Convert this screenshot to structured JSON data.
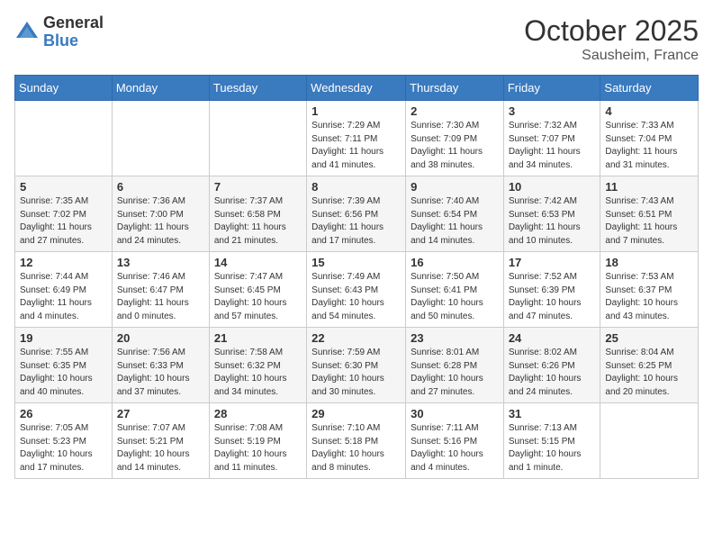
{
  "logo": {
    "general": "General",
    "blue": "Blue"
  },
  "header": {
    "month": "October 2025",
    "location": "Sausheim, France"
  },
  "days_of_week": [
    "Sunday",
    "Monday",
    "Tuesday",
    "Wednesday",
    "Thursday",
    "Friday",
    "Saturday"
  ],
  "weeks": [
    [
      {
        "num": "",
        "content": ""
      },
      {
        "num": "",
        "content": ""
      },
      {
        "num": "",
        "content": ""
      },
      {
        "num": "1",
        "content": "Sunrise: 7:29 AM\nSunset: 7:11 PM\nDaylight: 11 hours and 41 minutes."
      },
      {
        "num": "2",
        "content": "Sunrise: 7:30 AM\nSunset: 7:09 PM\nDaylight: 11 hours and 38 minutes."
      },
      {
        "num": "3",
        "content": "Sunrise: 7:32 AM\nSunset: 7:07 PM\nDaylight: 11 hours and 34 minutes."
      },
      {
        "num": "4",
        "content": "Sunrise: 7:33 AM\nSunset: 7:04 PM\nDaylight: 11 hours and 31 minutes."
      }
    ],
    [
      {
        "num": "5",
        "content": "Sunrise: 7:35 AM\nSunset: 7:02 PM\nDaylight: 11 hours and 27 minutes."
      },
      {
        "num": "6",
        "content": "Sunrise: 7:36 AM\nSunset: 7:00 PM\nDaylight: 11 hours and 24 minutes."
      },
      {
        "num": "7",
        "content": "Sunrise: 7:37 AM\nSunset: 6:58 PM\nDaylight: 11 hours and 21 minutes."
      },
      {
        "num": "8",
        "content": "Sunrise: 7:39 AM\nSunset: 6:56 PM\nDaylight: 11 hours and 17 minutes."
      },
      {
        "num": "9",
        "content": "Sunrise: 7:40 AM\nSunset: 6:54 PM\nDaylight: 11 hours and 14 minutes."
      },
      {
        "num": "10",
        "content": "Sunrise: 7:42 AM\nSunset: 6:53 PM\nDaylight: 11 hours and 10 minutes."
      },
      {
        "num": "11",
        "content": "Sunrise: 7:43 AM\nSunset: 6:51 PM\nDaylight: 11 hours and 7 minutes."
      }
    ],
    [
      {
        "num": "12",
        "content": "Sunrise: 7:44 AM\nSunset: 6:49 PM\nDaylight: 11 hours and 4 minutes."
      },
      {
        "num": "13",
        "content": "Sunrise: 7:46 AM\nSunset: 6:47 PM\nDaylight: 11 hours and 0 minutes."
      },
      {
        "num": "14",
        "content": "Sunrise: 7:47 AM\nSunset: 6:45 PM\nDaylight: 10 hours and 57 minutes."
      },
      {
        "num": "15",
        "content": "Sunrise: 7:49 AM\nSunset: 6:43 PM\nDaylight: 10 hours and 54 minutes."
      },
      {
        "num": "16",
        "content": "Sunrise: 7:50 AM\nSunset: 6:41 PM\nDaylight: 10 hours and 50 minutes."
      },
      {
        "num": "17",
        "content": "Sunrise: 7:52 AM\nSunset: 6:39 PM\nDaylight: 10 hours and 47 minutes."
      },
      {
        "num": "18",
        "content": "Sunrise: 7:53 AM\nSunset: 6:37 PM\nDaylight: 10 hours and 43 minutes."
      }
    ],
    [
      {
        "num": "19",
        "content": "Sunrise: 7:55 AM\nSunset: 6:35 PM\nDaylight: 10 hours and 40 minutes."
      },
      {
        "num": "20",
        "content": "Sunrise: 7:56 AM\nSunset: 6:33 PM\nDaylight: 10 hours and 37 minutes."
      },
      {
        "num": "21",
        "content": "Sunrise: 7:58 AM\nSunset: 6:32 PM\nDaylight: 10 hours and 34 minutes."
      },
      {
        "num": "22",
        "content": "Sunrise: 7:59 AM\nSunset: 6:30 PM\nDaylight: 10 hours and 30 minutes."
      },
      {
        "num": "23",
        "content": "Sunrise: 8:01 AM\nSunset: 6:28 PM\nDaylight: 10 hours and 27 minutes."
      },
      {
        "num": "24",
        "content": "Sunrise: 8:02 AM\nSunset: 6:26 PM\nDaylight: 10 hours and 24 minutes."
      },
      {
        "num": "25",
        "content": "Sunrise: 8:04 AM\nSunset: 6:25 PM\nDaylight: 10 hours and 20 minutes."
      }
    ],
    [
      {
        "num": "26",
        "content": "Sunrise: 7:05 AM\nSunset: 5:23 PM\nDaylight: 10 hours and 17 minutes."
      },
      {
        "num": "27",
        "content": "Sunrise: 7:07 AM\nSunset: 5:21 PM\nDaylight: 10 hours and 14 minutes."
      },
      {
        "num": "28",
        "content": "Sunrise: 7:08 AM\nSunset: 5:19 PM\nDaylight: 10 hours and 11 minutes."
      },
      {
        "num": "29",
        "content": "Sunrise: 7:10 AM\nSunset: 5:18 PM\nDaylight: 10 hours and 8 minutes."
      },
      {
        "num": "30",
        "content": "Sunrise: 7:11 AM\nSunset: 5:16 PM\nDaylight: 10 hours and 4 minutes."
      },
      {
        "num": "31",
        "content": "Sunrise: 7:13 AM\nSunset: 5:15 PM\nDaylight: 10 hours and 1 minute."
      },
      {
        "num": "",
        "content": ""
      }
    ]
  ]
}
